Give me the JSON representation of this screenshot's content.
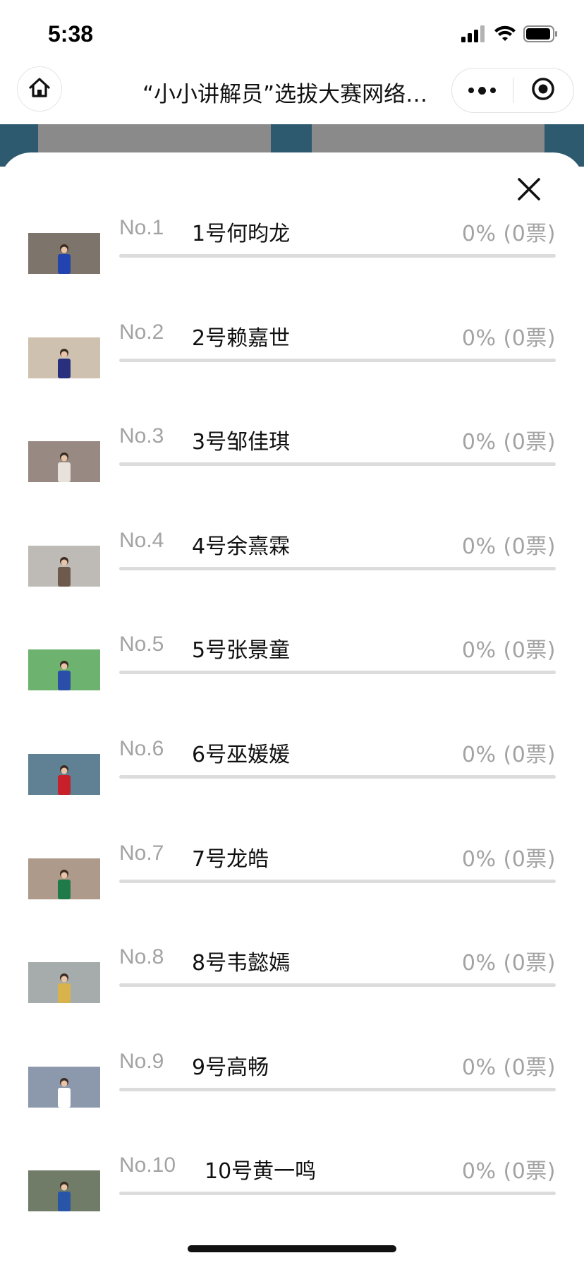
{
  "status_bar": {
    "time": "5:38"
  },
  "nav": {
    "title": "“小小讲解员”选拔大赛网络投票"
  },
  "candidates": [
    {
      "no": "No.1",
      "name": "1号何昀龙",
      "result": "0% (0票)",
      "share": 0,
      "thumb": {
        "bg": "#6b6158",
        "accent": "#2243b0"
      }
    },
    {
      "no": "No.2",
      "name": "2号赖嘉世",
      "result": "0% (0票)",
      "share": 0,
      "thumb": {
        "bg": "#c9b9a4",
        "accent": "#28307e"
      }
    },
    {
      "no": "No.3",
      "name": "3号邹佳琪",
      "result": "0% (0票)",
      "share": 0,
      "thumb": {
        "bg": "#8a7a72",
        "accent": "#e8e2dc"
      }
    },
    {
      "no": "No.4",
      "name": "4号余熹霖",
      "result": "0% (0票)",
      "share": 0,
      "thumb": {
        "bg": "#b5b2ad",
        "accent": "#6e5a4c"
      }
    },
    {
      "no": "No.5",
      "name": "5号张景童",
      "result": "0% (0票)",
      "share": 0,
      "thumb": {
        "bg": "#5aa85c",
        "accent": "#2b4fa8"
      }
    },
    {
      "no": "No.6",
      "name": "6号巫媛媛",
      "result": "0% (0票)",
      "share": 0,
      "thumb": {
        "bg": "#4a6f86",
        "accent": "#c7202a"
      }
    },
    {
      "no": "No.7",
      "name": "7号龙皓",
      "result": "0% (0票)",
      "share": 0,
      "thumb": {
        "bg": "#a28c7a",
        "accent": "#1f7a4a"
      }
    },
    {
      "no": "No.8",
      "name": "8号韦懿嫣",
      "result": "0% (0票)",
      "share": 0,
      "thumb": {
        "bg": "#9aa0a0",
        "accent": "#d8b24a"
      }
    },
    {
      "no": "No.9",
      "name": "9号高畅",
      "result": "0% (0票)",
      "share": 0,
      "thumb": {
        "bg": "#7d8aa0",
        "accent": "#ffffff"
      }
    },
    {
      "no": "No.10",
      "name": "10号黄一鸣",
      "result": "0% (0票)",
      "share": 0,
      "thumb": {
        "bg": "#5d6a52",
        "accent": "#2855a8"
      }
    }
  ],
  "colors": {
    "header_strip": "#2e5a70",
    "track": "#dcdcdc",
    "muted_text": "#a3a3a3"
  }
}
